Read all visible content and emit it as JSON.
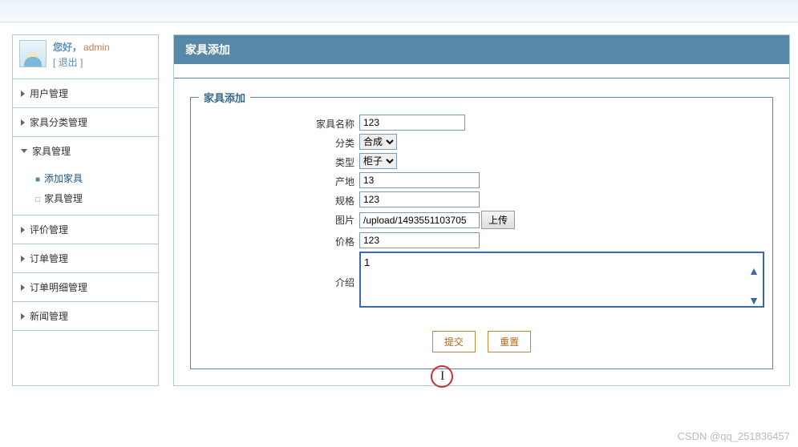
{
  "user": {
    "greeting": "您好，",
    "name": "admin",
    "logoutPrefix": "[ ",
    "logoutText": "退出",
    "logoutSuffix": " ]"
  },
  "sidebar": {
    "items": [
      {
        "label": "用户管理"
      },
      {
        "label": "家具分类管理"
      },
      {
        "label": "家具管理",
        "open": true,
        "children": [
          {
            "label": "添加家具",
            "active": true
          },
          {
            "label": "家具管理"
          }
        ]
      },
      {
        "label": "评价管理"
      },
      {
        "label": "订单管理"
      },
      {
        "label": "订单明细管理"
      },
      {
        "label": "新闻管理"
      }
    ]
  },
  "page": {
    "title": "家具添加",
    "legend": "家具添加"
  },
  "form": {
    "nameLabel": "家具名称",
    "nameValue": "123",
    "categoryLabel": "分类",
    "categoryValue": "合成",
    "typeLabel": "类型",
    "typeValue": "柜子",
    "originLabel": "产地",
    "originValue": "13",
    "specLabel": "规格",
    "specValue": "123",
    "imageLabel": "图片",
    "imageValue": "/upload/1493551103705",
    "uploadBtn": "上传",
    "priceLabel": "价格",
    "priceValue": "123",
    "descLabel": "介绍",
    "descValue": "1",
    "submitBtn": "提交",
    "resetBtn": "重置"
  },
  "watermark": "CSDN @qq_251836457"
}
